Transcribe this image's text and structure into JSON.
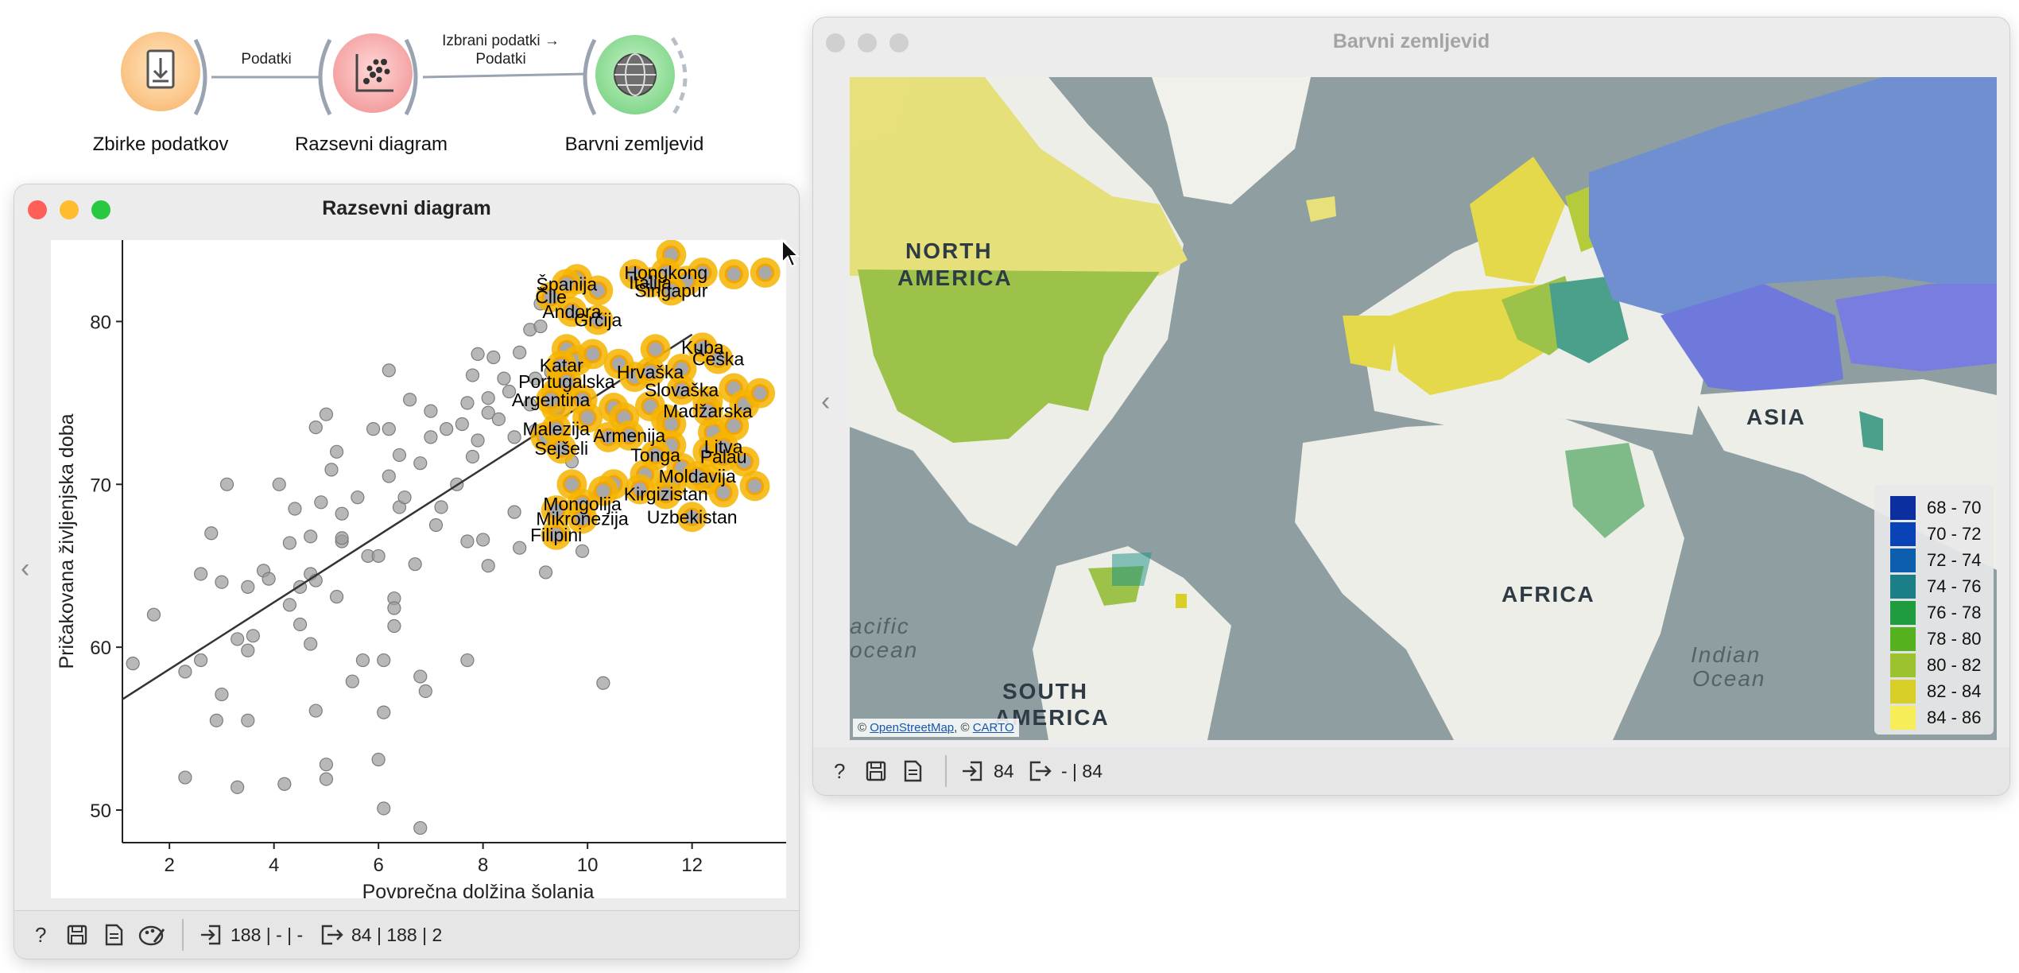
{
  "workflow": {
    "nodes": [
      {
        "label": "Zbirke podatkov",
        "icon": "file-import-icon"
      },
      {
        "label": "Razsevni diagram",
        "icon": "scatter-plot-icon"
      },
      {
        "label": "Barvni zemljevid",
        "icon": "globe-icon"
      }
    ],
    "edges": [
      {
        "label_line1": "Podatki",
        "label_line2": ""
      },
      {
        "label_line1": "Izbrani podatki →",
        "label_line2": "Podatki"
      }
    ]
  },
  "scatter_window": {
    "title": "Razsevni diagram",
    "status": {
      "input_summary": "188 | - | -",
      "output_summary": "84 | 188 | 2"
    },
    "icons": [
      "help-icon",
      "save-icon",
      "report-icon",
      "palette-icon",
      "input-icon",
      "output-icon"
    ]
  },
  "map_window": {
    "title": "Barvni zemljevid",
    "status": {
      "input_summary": "84",
      "output_summary": "- | 84"
    },
    "attribution_osm": "OpenStreetMap",
    "attribution_sep": ", ©",
    "attribution_carto": "CARTO",
    "attribution_prefix": "©",
    "map_labels": {
      "north_america_1": "NORTH",
      "north_america_2": "AMERICA",
      "south_america_1": "SOUTH",
      "south_america_2": "AMERICA",
      "africa": "AFRICA",
      "asia": "ASIA",
      "pacific_1": "acific",
      "pacific_2": "ocean",
      "indian_1": "Indian",
      "indian_2": "Ocean"
    },
    "legend": [
      {
        "label": "68 - 70",
        "color": "#0b2f9e"
      },
      {
        "label": "70 - 72",
        "color": "#0a43b5"
      },
      {
        "label": "72 - 74",
        "color": "#0d5fae"
      },
      {
        "label": "74 - 76",
        "color": "#1a7f86"
      },
      {
        "label": "76 - 78",
        "color": "#1f9c3f"
      },
      {
        "label": "78 - 80",
        "color": "#56b11e"
      },
      {
        "label": "80 - 82",
        "color": "#9cc22f"
      },
      {
        "label": "82 - 84",
        "color": "#d7cf25"
      },
      {
        "label": "84 - 86",
        "color": "#f7ec5a"
      }
    ]
  },
  "chart_data": {
    "type": "scatter",
    "xlabel": "Povprečna dolžina šolanja",
    "ylabel": "Pričakovana življenjska doba",
    "xlim": [
      1.1,
      13.8
    ],
    "ylim": [
      48,
      85
    ],
    "x_ticks": [
      2,
      4,
      6,
      8,
      10,
      12
    ],
    "y_ticks": [
      50,
      60,
      70,
      80
    ],
    "regression_line": {
      "x": [
        1.1,
        12.0
      ],
      "y": [
        56.8,
        79.2
      ]
    },
    "series": [
      {
        "selected": false,
        "points": [
          [
            1.3,
            59
          ],
          [
            1.7,
            62
          ],
          [
            2.3,
            52
          ],
          [
            2.3,
            58.5
          ],
          [
            2.6,
            64.5
          ],
          [
            2.6,
            59.2
          ],
          [
            2.8,
            67
          ],
          [
            2.9,
            55.5
          ],
          [
            3.0,
            57.1
          ],
          [
            3.0,
            64
          ],
          [
            3.1,
            70
          ],
          [
            3.3,
            51.4
          ],
          [
            3.3,
            60.5
          ],
          [
            3.5,
            63.7
          ],
          [
            3.5,
            55.5
          ],
          [
            3.5,
            59.8
          ],
          [
            3.6,
            60.7
          ],
          [
            3.8,
            64.7
          ],
          [
            3.9,
            64.2
          ],
          [
            4.1,
            70
          ],
          [
            4.2,
            51.6
          ],
          [
            4.3,
            62.6
          ],
          [
            4.3,
            66.4
          ],
          [
            4.4,
            68.5
          ],
          [
            4.5,
            63.7
          ],
          [
            4.5,
            61.4
          ],
          [
            4.7,
            66.8
          ],
          [
            4.7,
            60.2
          ],
          [
            4.7,
            64.5
          ],
          [
            4.8,
            73.5
          ],
          [
            4.8,
            56.1
          ],
          [
            4.8,
            64.1
          ],
          [
            4.9,
            68.9
          ],
          [
            5.0,
            74.3
          ],
          [
            5.0,
            51.9
          ],
          [
            5.0,
            52.8
          ],
          [
            5.1,
            70.9
          ],
          [
            5.2,
            63.1
          ],
          [
            5.2,
            72
          ],
          [
            5.3,
            66.5
          ],
          [
            5.3,
            66.7
          ],
          [
            5.3,
            68.2
          ],
          [
            5.5,
            57.9
          ],
          [
            5.6,
            69.2
          ],
          [
            5.7,
            59.2
          ],
          [
            5.8,
            65.6
          ],
          [
            5.9,
            73.4
          ],
          [
            6.0,
            53.1
          ],
          [
            6.0,
            65.6
          ],
          [
            6.1,
            59.2
          ],
          [
            6.1,
            56
          ],
          [
            6.1,
            50.1
          ],
          [
            6.2,
            77
          ],
          [
            6.2,
            73.4
          ],
          [
            6.2,
            70.5
          ],
          [
            6.3,
            61.3
          ],
          [
            6.3,
            63
          ],
          [
            6.3,
            62.4
          ],
          [
            6.4,
            71.8
          ],
          [
            6.4,
            68.6
          ],
          [
            6.5,
            69.2
          ],
          [
            6.6,
            75.2
          ],
          [
            6.7,
            65.1
          ],
          [
            6.8,
            48.9
          ],
          [
            6.8,
            71.3
          ],
          [
            6.8,
            58.2
          ],
          [
            6.9,
            57.3
          ],
          [
            7.0,
            72.9
          ],
          [
            7.0,
            74.5
          ],
          [
            7.1,
            67.5
          ],
          [
            7.2,
            68.6
          ],
          [
            7.3,
            73.4
          ],
          [
            7.5,
            70
          ],
          [
            7.6,
            73.7
          ],
          [
            7.7,
            75
          ],
          [
            7.7,
            59.2
          ],
          [
            7.7,
            66.5
          ],
          [
            7.8,
            71.7
          ],
          [
            7.8,
            76.7
          ],
          [
            7.9,
            78
          ],
          [
            7.9,
            72.7
          ],
          [
            8.0,
            66.6
          ],
          [
            8.1,
            65
          ],
          [
            8.1,
            75.3
          ],
          [
            8.1,
            74.4
          ],
          [
            8.2,
            77.8
          ],
          [
            8.3,
            74
          ],
          [
            8.4,
            76.5
          ],
          [
            8.5,
            75.7
          ],
          [
            8.6,
            68.3
          ],
          [
            8.6,
            72.9
          ],
          [
            8.7,
            78.1
          ],
          [
            8.7,
            66.1
          ],
          [
            8.9,
            79.5
          ],
          [
            8.9,
            74.9
          ],
          [
            9.0,
            76.5
          ],
          [
            9.0,
            73.3
          ],
          [
            9.1,
            79.7
          ],
          [
            9.1,
            81.1
          ],
          [
            9.2,
            64.6
          ],
          [
            9.3,
            76.9
          ],
          [
            9.7,
            71.4
          ],
          [
            9.9,
            65.9
          ],
          [
            10.2,
            69.3
          ],
          [
            10.3,
            57.8
          ]
        ]
      },
      {
        "selected": true,
        "labeled_points": [
          {
            "x": 11.5,
            "y": 83,
            "label": "Hongkong"
          },
          {
            "x": 9.6,
            "y": 82.3,
            "label": "Španija"
          },
          {
            "x": 11.2,
            "y": 82.4,
            "label": "Italija"
          },
          {
            "x": 11.6,
            "y": 81.9,
            "label": "Singapur"
          },
          {
            "x": 9.3,
            "y": 81.5,
            "label": "Čile"
          },
          {
            "x": 9.7,
            "y": 80.6,
            "label": "Andora"
          },
          {
            "x": 10.2,
            "y": 80.1,
            "label": "Grčija"
          },
          {
            "x": 12.2,
            "y": 78.4,
            "label": "Kuba"
          },
          {
            "x": 12.5,
            "y": 77.7,
            "label": "Češka"
          },
          {
            "x": 9.5,
            "y": 77.3,
            "label": "Katar"
          },
          {
            "x": 11.2,
            "y": 76.9,
            "label": "Hrvaška"
          },
          {
            "x": 9.6,
            "y": 76.3,
            "label": "Portugalska"
          },
          {
            "x": 11.8,
            "y": 75.8,
            "label": "Slovaška"
          },
          {
            "x": 9.3,
            "y": 75.2,
            "label": "Argentina"
          },
          {
            "x": 12.3,
            "y": 74.5,
            "label": "Madžarska"
          },
          {
            "x": 9.4,
            "y": 73.4,
            "label": "Malezija"
          },
          {
            "x": 10.8,
            "y": 73.0,
            "label": "Armenija"
          },
          {
            "x": 9.5,
            "y": 72.2,
            "label": "Sejšeli"
          },
          {
            "x": 11.3,
            "y": 71.8,
            "label": "Tonga"
          },
          {
            "x": 12.6,
            "y": 71.7,
            "label": "Palau"
          },
          {
            "x": 12.6,
            "y": 72.3,
            "label": "Litva"
          },
          {
            "x": 12.1,
            "y": 70.5,
            "label": "Moldavija"
          },
          {
            "x": 9.9,
            "y": 68.8,
            "label": "Mongolija"
          },
          {
            "x": 11.5,
            "y": 69.4,
            "label": "Kirgizistan"
          },
          {
            "x": 9.9,
            "y": 67.9,
            "label": "Mikronezija"
          },
          {
            "x": 12.0,
            "y": 68.0,
            "label": "Uzbekistan"
          },
          {
            "x": 9.4,
            "y": 66.9,
            "label": "Filipini"
          }
        ],
        "points": [
          [
            9.8,
            82.6
          ],
          [
            10.2,
            81.9
          ],
          [
            10.9,
            82.9
          ],
          [
            11.6,
            84.1
          ],
          [
            12.2,
            83
          ],
          [
            12.8,
            82.9
          ],
          [
            13.4,
            83
          ],
          [
            11.9,
            82.5
          ],
          [
            9.6,
            78.3
          ],
          [
            9.8,
            77.6
          ],
          [
            10.1,
            78
          ],
          [
            10.6,
            77.4
          ],
          [
            11.3,
            78.3
          ],
          [
            9.5,
            76.9
          ],
          [
            10.9,
            76.6
          ],
          [
            11.8,
            77.1
          ],
          [
            9.4,
            75.6
          ],
          [
            9.9,
            75.2
          ],
          [
            10.5,
            74.7
          ],
          [
            11.2,
            74.8
          ],
          [
            11.5,
            74
          ],
          [
            12.3,
            75.1
          ],
          [
            12.8,
            75.9
          ],
          [
            13.0,
            74.9
          ],
          [
            9.4,
            74.7
          ],
          [
            10.0,
            74.1
          ],
          [
            10.7,
            74.1
          ],
          [
            11.6,
            73.7
          ],
          [
            12.4,
            73.2
          ],
          [
            9.2,
            72.9
          ],
          [
            10.4,
            72.9
          ],
          [
            11.6,
            72.4
          ],
          [
            9.7,
            70
          ],
          [
            10.5,
            70
          ],
          [
            11.1,
            70.6
          ],
          [
            11.8,
            71
          ],
          [
            12.3,
            70.3
          ],
          [
            9.4,
            68.4
          ],
          [
            10.3,
            69.6
          ],
          [
            11.0,
            69.7
          ],
          [
            11.6,
            70
          ],
          [
            12.6,
            69.5
          ],
          [
            13.2,
            69.9
          ],
          [
            13.0,
            71.4
          ],
          [
            12.3,
            72
          ],
          [
            12.8,
            73.6
          ],
          [
            13.3,
            75.6
          ]
        ]
      }
    ]
  }
}
